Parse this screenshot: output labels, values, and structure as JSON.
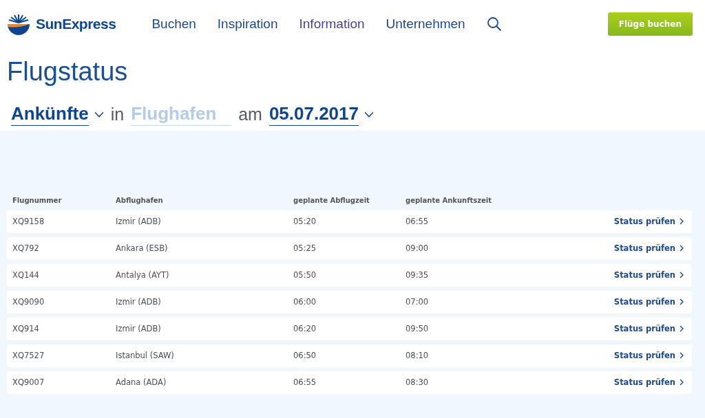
{
  "header": {
    "brand": "SunExpress",
    "nav": [
      {
        "label": "Buchen"
      },
      {
        "label": "Inspiration"
      },
      {
        "label": "Information"
      },
      {
        "label": "Unternehmen"
      }
    ],
    "cta": "Flüge buchen"
  },
  "title": "Flugstatus",
  "filter": [
    {
      "kind": "dropdown",
      "value": "Ankünfte"
    },
    {
      "kind": "word",
      "text": "in"
    },
    {
      "kind": "input",
      "placeholder": "Flughafen"
    },
    {
      "kind": "word",
      "text": "am"
    },
    {
      "kind": "dropdown",
      "value": "05.07.2017"
    }
  ],
  "table": {
    "columns": [
      "Flugnummer",
      "Abflughafen",
      "geplante Abflugzeit",
      "geplante Ankunftszeit"
    ],
    "rows": [
      {
        "cells": [
          "XQ9158",
          "Izmir (ADB)",
          "05:20",
          "06:55"
        ],
        "action": "Status prüfen"
      },
      {
        "cells": [
          "XQ792",
          "Ankara (ESB)",
          "05:25",
          "09:00"
        ],
        "action": "Status prüfen"
      },
      {
        "cells": [
          "XQ144",
          "Antalya (AYT)",
          "05:50",
          "09:35"
        ],
        "action": "Status prüfen"
      },
      {
        "cells": [
          "XQ9090",
          "Izmir (ADB)",
          "06:00",
          "07:00"
        ],
        "action": "Status prüfen"
      },
      {
        "cells": [
          "XQ914",
          "Izmir (ADB)",
          "06:20",
          "09:50"
        ],
        "action": "Status prüfen"
      },
      {
        "cells": [
          "XQ7527",
          "Istanbul (SAW)",
          "06:50",
          "08:10"
        ],
        "action": "Status prüfen"
      },
      {
        "cells": [
          "XQ9007",
          "Adana (ADA)",
          "06:55",
          "08:30"
        ],
        "action": "Status prüfen"
      }
    ]
  }
}
